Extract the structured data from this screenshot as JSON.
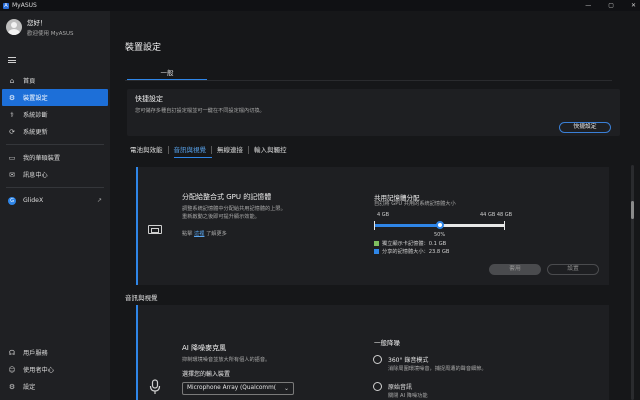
{
  "app": {
    "title": "MyASUS",
    "logo": "A"
  },
  "window_controls": {
    "minimize": "—",
    "maximize": "▢",
    "close": "✕"
  },
  "user": {
    "greeting": "您好！",
    "welcome": "歡迎使用 MyASUS"
  },
  "sidebar": {
    "items": [
      {
        "label": "首頁",
        "icon": "home-icon",
        "glyph": "⌂"
      },
      {
        "label": "裝置設定",
        "icon": "sliders-icon",
        "glyph": "⚙"
      },
      {
        "label": "系統診斷",
        "icon": "diagnose-icon",
        "glyph": "⚕"
      },
      {
        "label": "系統更新",
        "icon": "update-icon",
        "glyph": "⟳"
      },
      {
        "label": "我的華碩裝置",
        "icon": "device-icon",
        "glyph": "▭"
      },
      {
        "label": "訊息中心",
        "icon": "message-icon",
        "glyph": "✉"
      },
      {
        "label": "GlideX",
        "icon": "glidex-icon",
        "glyph": "G"
      }
    ],
    "bottom_items": [
      {
        "label": "用戶服務",
        "icon": "headset-icon",
        "glyph": "☊"
      },
      {
        "label": "使用者中心",
        "icon": "user-icon",
        "glyph": "☺"
      },
      {
        "label": "設定",
        "icon": "gear-icon",
        "glyph": "⚙"
      }
    ]
  },
  "main": {
    "title": "裝置設定",
    "tab": "一般",
    "quick": {
      "title": "快捷設定",
      "desc": "您可儲存多種自訂設定檔並可一鍵在不同設定檔內切換。",
      "button": "快捷設定"
    },
    "subtabs": [
      "電池與效能",
      "音訊與視覺",
      "無線連接",
      "輸入與觸控"
    ],
    "gpu_card": {
      "title": "分配給整合式 GPU 的記憶體",
      "desc1": "調整系統記憶體中分配給共用記憶體的上限。",
      "desc2": "重新啟動之後即可提升顯示效能。",
      "link_prefix": "點擊",
      "link": "這裡",
      "link_suffix": "了解更多",
      "memory": {
        "title": "共用記憶體分配",
        "sub": "自訂將 GPU 共用的系統記憶體大小",
        "min_label": "4 GB",
        "max_label": "44 GB 48 GB",
        "percent": "50%",
        "value_fraction": 0.5,
        "legend": [
          {
            "label": "獨立顯示卡記憶體：0.1 GB",
            "color": "#7fbf5f"
          },
          {
            "label": "分享的記憶體大小：23.8 GB",
            "color": "#2f86e8"
          }
        ]
      },
      "apply": "套用",
      "reset": "設置"
    },
    "section_label": "音訊與視覺",
    "ai_card": {
      "title": "AI 降噪麥克風",
      "desc": "抑制環境噪音並放大所有個人的語音。",
      "select_label": "選擇您的輸入裝置",
      "select_value": "Microphone Array (Qualcomm(",
      "nr_title": "一般降噪",
      "options": [
        {
          "label": "360° 錄音模式",
          "desc": "消除周圍環境噪音，捕捉周遭的聲音細節。"
        },
        {
          "label": "原始音訊",
          "desc": "關閉 AI 降噪功能"
        }
      ]
    }
  },
  "colors": {
    "accent": "#2f86e8",
    "sidebar_active": "#1d6fd8"
  }
}
